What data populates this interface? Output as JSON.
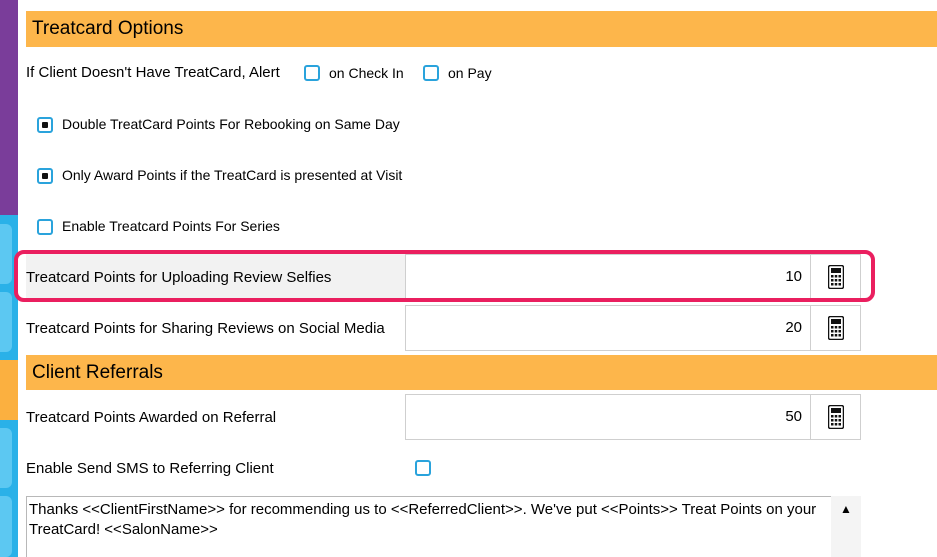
{
  "treatcard_section": {
    "title": "Treatcard Options",
    "alert_label": "If Client Doesn't Have TreatCard, Alert",
    "alert_options": [
      {
        "label": "on Check In",
        "checked": false
      },
      {
        "label": "on Pay",
        "checked": false
      }
    ],
    "checkbox_options": [
      {
        "label": "Double TreatCard Points For Rebooking on Same Day",
        "checked": true
      },
      {
        "label": "Only Award Points if the TreatCard is presented at Visit",
        "checked": true
      },
      {
        "label": "Enable Treatcard Points For Series",
        "checked": false
      }
    ],
    "fields": [
      {
        "label": "Treatcard Points for Uploading Review Selfies",
        "value": "10"
      },
      {
        "label": "Treatcard Points for Sharing Reviews on Social Media",
        "value": "20"
      }
    ]
  },
  "referral_section": {
    "title": "Client Referrals",
    "points_label": "Treatcard Points Awarded on Referral",
    "points_value": "50",
    "sms_label": "Enable Send SMS to Referring Client",
    "sms_checked": false,
    "message": "Thanks <<ClientFirstName>> for recommending us to <<ReferredClient>>. We've put <<Points>> Treat Points on your TreatCard! <<SalonName>>",
    "scroll_up_glyph": "▲"
  },
  "icons": {
    "calculator": "calculator-icon",
    "scroll_up": "arrow-up-icon"
  },
  "colors": {
    "section_header": "#fdb64b",
    "checkbox_border": "#2aa3dc",
    "highlight": "#ea1f5f",
    "sidebar_purple": "#7a3d9a",
    "sidebar_blue": "#2ab1e8"
  }
}
